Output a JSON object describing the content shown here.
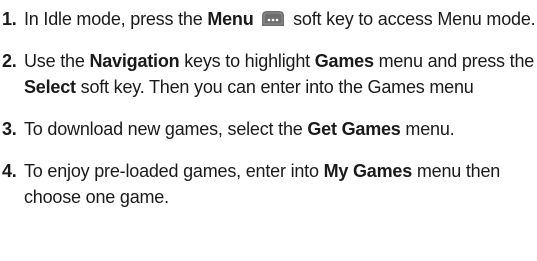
{
  "steps": [
    {
      "number": "1.",
      "segments": [
        {
          "text": "In Idle mode, press the ",
          "bold": false
        },
        {
          "text": "Menu",
          "bold": true
        },
        {
          "icon": "menu-soft-key-icon"
        },
        {
          "text": " soft key to access Menu mode.",
          "bold": false
        }
      ]
    },
    {
      "number": "2.",
      "segments": [
        {
          "text": "Use the ",
          "bold": false
        },
        {
          "text": "Navigation",
          "bold": true
        },
        {
          "text": " keys to highlight ",
          "bold": false
        },
        {
          "text": "Games",
          "bold": true
        },
        {
          "text": " menu and press the ",
          "bold": false
        },
        {
          "text": "Select",
          "bold": true
        },
        {
          "text": " soft key. Then you can enter into the Games menu",
          "bold": false
        }
      ]
    },
    {
      "number": "3.",
      "segments": [
        {
          "text": "To download new games, select the ",
          "bold": false
        },
        {
          "text": "Get Games",
          "bold": true
        },
        {
          "text": " menu.",
          "bold": false
        }
      ]
    },
    {
      "number": "4.",
      "segments": [
        {
          "text": "To enjoy pre-loaded games, enter into ",
          "bold": false
        },
        {
          "text": "My Games",
          "bold": true
        },
        {
          "text": " menu then choose one game.",
          "bold": false
        }
      ]
    }
  ],
  "colors": {
    "text": "#1a1a1a",
    "icon_fill": "#6e6e6e"
  }
}
